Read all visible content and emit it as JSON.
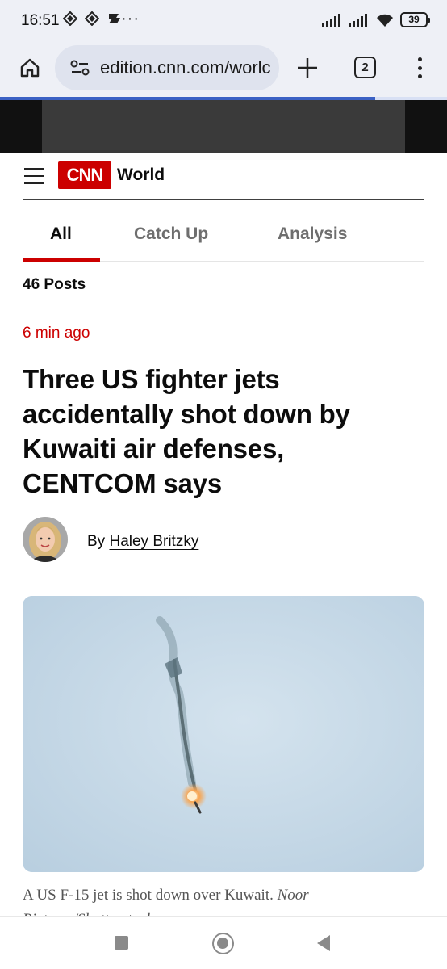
{
  "status_bar": {
    "time": "16:51",
    "more": "···",
    "battery": "39",
    "icons": [
      "data-saver-icon",
      "data-saver-icon",
      "key-icon",
      "signal-icon",
      "signal-icon",
      "wifi-icon",
      "battery-icon"
    ]
  },
  "browser": {
    "url": "edition.cnn.com/worlc",
    "tab_count": "2",
    "load_progress": 0.84,
    "accent": "#3b61c4"
  },
  "header": {
    "logo": "CNN",
    "section": "World",
    "brand_color": "#cc0000"
  },
  "tabs": [
    {
      "label": "All",
      "active": true
    },
    {
      "label": "Catch Up",
      "active": false
    },
    {
      "label": "Analysis",
      "active": false
    }
  ],
  "feed": {
    "posts_count": "46 Posts"
  },
  "post": {
    "timestamp": "6 min ago",
    "headline": "Three US fighter jets accidentally shot down by Kuwaiti air defenses, CENTCOM says",
    "byline_prefix": "By",
    "author": "Haley Britzky",
    "caption": "A US F-15 jet is shot down over Kuwait.",
    "caption_credit": "Noor Pictures/Shutterstock"
  }
}
